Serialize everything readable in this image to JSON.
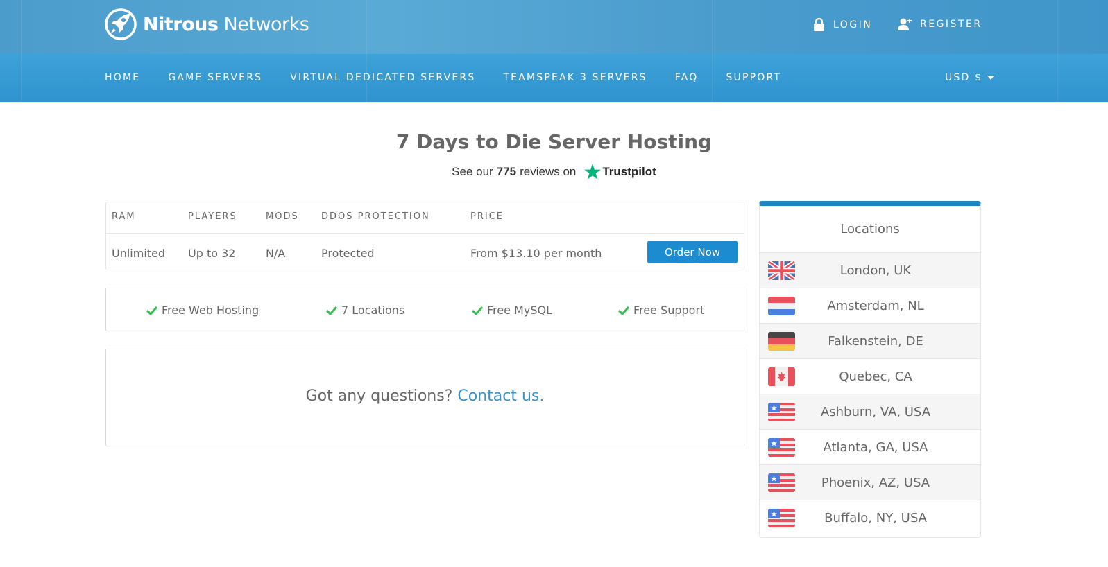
{
  "brand": {
    "name_bold": "Nitrous",
    "name_light": " Networks"
  },
  "account": {
    "login": "LOGIN",
    "register": "REGISTER"
  },
  "nav": {
    "items": [
      "HOME",
      "GAME SERVERS",
      "VIRTUAL DEDICATED SERVERS",
      "TEAMSPEAK 3 SERVERS",
      "FAQ",
      "SUPPORT"
    ],
    "currency": "USD $"
  },
  "page": {
    "title": "7 Days to Die Server Hosting",
    "reviews_prefix": "See our",
    "reviews_count": "775",
    "reviews_suffix": "reviews on",
    "trustpilot": "Trustpilot"
  },
  "plan": {
    "headers": {
      "ram": "RAM",
      "players": "PLAYERS",
      "mods": "MODS",
      "ddos": "DDOS PROTECTION",
      "price": "PRICE"
    },
    "values": {
      "ram": "Unlimited",
      "players": "Up to 32",
      "mods": "N/A",
      "ddos": "Protected",
      "price": "From $13.10 per month"
    },
    "order_label": "Order Now"
  },
  "features": [
    "Free Web Hosting",
    "7 Locations",
    "Free MySQL",
    "Free Support"
  ],
  "contact": {
    "question": "Got any questions?",
    "link": "Contact us."
  },
  "locations": {
    "title": "Locations",
    "items": [
      {
        "name": "London, UK",
        "flag": "uk"
      },
      {
        "name": "Amsterdam, NL",
        "flag": "nl"
      },
      {
        "name": "Falkenstein, DE",
        "flag": "de"
      },
      {
        "name": "Quebec, CA",
        "flag": "ca"
      },
      {
        "name": "Ashburn, VA, USA",
        "flag": "us"
      },
      {
        "name": "Atlanta, GA, USA",
        "flag": "us"
      },
      {
        "name": "Phoenix, AZ, USA",
        "flag": "us"
      },
      {
        "name": "Buffalo, NY, USA",
        "flag": "us"
      }
    ]
  },
  "colors": {
    "header": "#4b9ccb",
    "nav": "#3399d3",
    "accent": "#1c8bd0",
    "check": "#2fbf4a",
    "link": "#3593c7"
  }
}
